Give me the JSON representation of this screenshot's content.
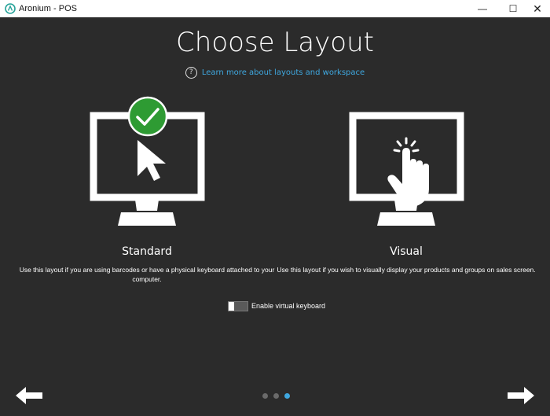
{
  "window": {
    "title": "Aronium - POS",
    "accent": "#3fa8e0",
    "controls": {
      "minimize": "—",
      "maximize": "☐",
      "close": "✕"
    }
  },
  "header": {
    "title": "Choose Layout",
    "help_icon": "question-circle-icon",
    "help_glyph": "?",
    "help_link": "Learn more about layouts and workspace"
  },
  "options": [
    {
      "id": "standard",
      "title": "Standard",
      "description": "Use this layout if you are using barcodes or have a physical keyboard attached to your computer.",
      "icon": "monitor-cursor-icon",
      "selected": true,
      "selected_color": "#2e9b33"
    },
    {
      "id": "visual",
      "title": "Visual",
      "description": "Use this layout if you wish to visually display your products and groups on sales screen.",
      "icon": "monitor-touch-icon",
      "selected": false
    }
  ],
  "virtual_keyboard": {
    "label": "Enable virtual keyboard",
    "enabled": false
  },
  "navigation": {
    "back_icon": "arrow-left-icon",
    "next_icon": "arrow-right-icon",
    "page_count": 3,
    "current_page": 3,
    "dot_inactive": "#6a6a6a",
    "dot_active": "#3fa8e0"
  }
}
